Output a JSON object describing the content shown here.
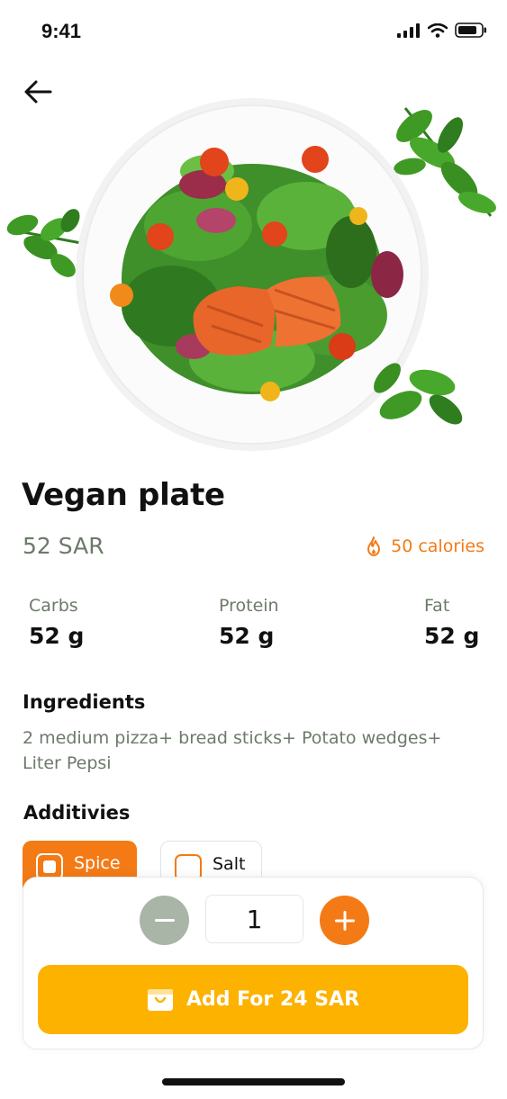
{
  "status_bar": {
    "time": "9:41"
  },
  "dish": {
    "title": "Vegan plate",
    "price": "52 SAR",
    "calories": "50 calories"
  },
  "nutrition": [
    {
      "label": "Carbs",
      "value": "52 g"
    },
    {
      "label": "Protein",
      "value": "52 g"
    },
    {
      "label": "Fat",
      "value": "52 g"
    }
  ],
  "ingredients": {
    "title": "Ingredients",
    "text": "2 medium pizza+ bread sticks+ Potato wedges+ Liter Pepsi"
  },
  "additives": {
    "title": "Additivies",
    "options": [
      {
        "label": "Spice",
        "selected": true
      },
      {
        "label": "Salt",
        "selected": false
      }
    ]
  },
  "cart": {
    "quantity": "1",
    "add_label": "Add For 24 SAR"
  },
  "colors": {
    "accent_orange": "#f47a15",
    "add_button_yellow": "#fdb200",
    "muted_green_gray": "#6c7a6a",
    "minus_button": "#a9b5a6"
  },
  "icons": [
    "back-arrow-icon",
    "flame-icon",
    "minus-icon",
    "plus-icon",
    "shopping-bag-icon",
    "signal-icon",
    "wifi-icon",
    "battery-icon"
  ]
}
